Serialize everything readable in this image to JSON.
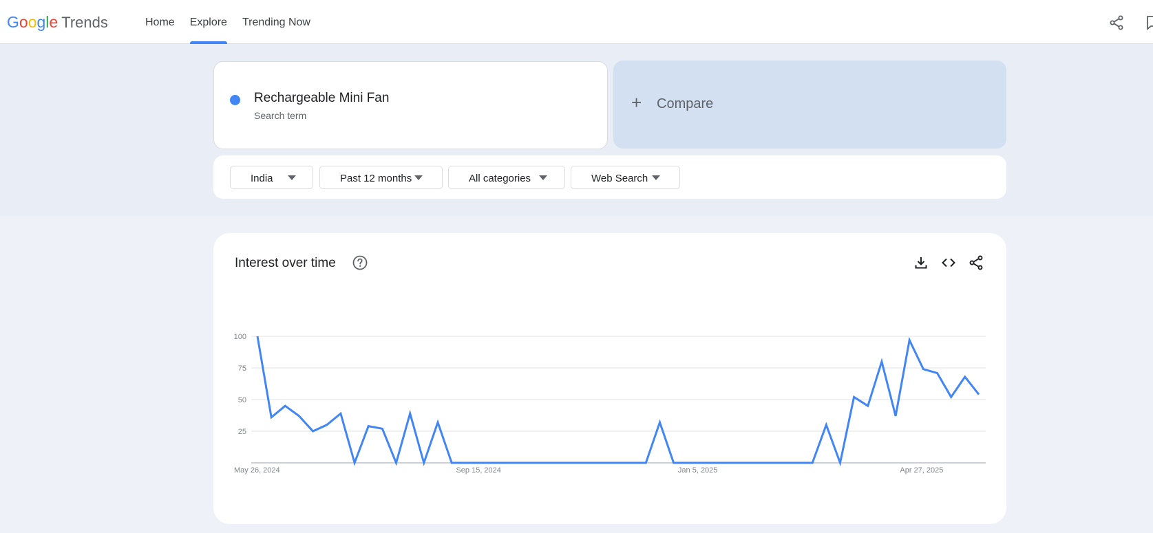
{
  "header": {
    "logo_letters": [
      {
        "ch": "G",
        "color": "#4285F4"
      },
      {
        "ch": "o",
        "color": "#EA4335"
      },
      {
        "ch": "o",
        "color": "#FBBC05"
      },
      {
        "ch": "g",
        "color": "#4285F4"
      },
      {
        "ch": "l",
        "color": "#34A853"
      },
      {
        "ch": "e",
        "color": "#EA4335"
      }
    ],
    "product": "Trends",
    "nav": [
      {
        "label": "Home",
        "active": false
      },
      {
        "label": "Explore",
        "active": true
      },
      {
        "label": "Trending Now",
        "active": false
      }
    ],
    "icons": [
      "share-icon",
      "feedback-icon"
    ]
  },
  "search": {
    "term": "Rechargeable Mini Fan",
    "term_type": "Search term",
    "term_color": "#4285F4",
    "compare_label": "Compare"
  },
  "filters": {
    "region": "India",
    "time_range": "Past 12 months",
    "category": "All categories",
    "property": "Web Search"
  },
  "chart_card": {
    "title": "Interest over time",
    "icons": [
      "help-icon",
      "download-icon",
      "embed-icon",
      "share-icon"
    ]
  },
  "chart_data": {
    "type": "line",
    "title": "Interest over time",
    "xlabel": "",
    "ylabel": "",
    "ylim": [
      0,
      100
    ],
    "yticks": [
      25,
      50,
      75,
      100
    ],
    "grid": true,
    "x_tick_labels": [
      {
        "label": "May 26, 2024",
        "index": 0
      },
      {
        "label": "Sep 15, 2024",
        "index": 16
      },
      {
        "label": "Jan 5, 2025",
        "index": 32
      },
      {
        "label": "Apr 27, 2025",
        "index": 48
      }
    ],
    "series": [
      {
        "color": "#4285F4",
        "values": [
          100,
          36,
          45,
          37,
          25,
          30,
          39,
          0,
          29,
          27,
          0,
          39,
          0,
          32,
          0,
          0,
          0,
          0,
          0,
          0,
          0,
          0,
          0,
          0,
          0,
          0,
          0,
          0,
          0,
          32,
          0,
          0,
          0,
          0,
          0,
          0,
          0,
          0,
          0,
          0,
          0,
          30,
          0,
          52,
          45,
          80,
          37,
          97,
          74,
          71,
          52,
          68,
          54
        ]
      }
    ]
  }
}
